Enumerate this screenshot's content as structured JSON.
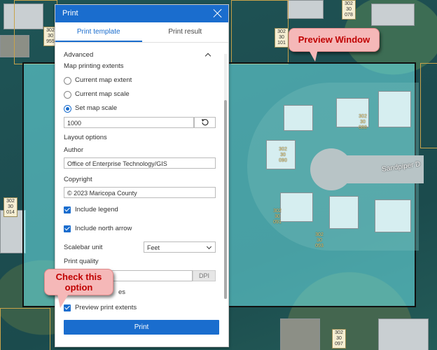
{
  "panel": {
    "title": "Print",
    "tabs": [
      {
        "label": "Print template"
      },
      {
        "label": "Print result"
      }
    ],
    "advanced": {
      "label": "Advanced",
      "extents_label": "Map printing extents",
      "options": [
        {
          "label": "Current map extent"
        },
        {
          "label": "Current map scale"
        },
        {
          "label": "Set map scale"
        }
      ],
      "scale_value": "1000",
      "layout_options_label": "Layout options",
      "author_label": "Author",
      "author_value": "Office of Enterprise Technology/GIS",
      "copyright_label": "Copyright",
      "copyright_value": "© 2023 Maricopa County",
      "include_legend_label": "Include legend",
      "include_north_arrow_label": "Include north arrow",
      "scalebar_unit_label": "Scalebar unit",
      "scalebar_unit_value": "Feet",
      "print_quality_label": "Print quality",
      "dpi_label": "DPI",
      "partial_label": "es",
      "preview_label": "Preview print extents"
    },
    "print_button": "Print"
  },
  "callouts": {
    "preview_window": "Preview Window",
    "check_option": "Check this option"
  },
  "map": {
    "road_label": "Sandpiper D",
    "parcels": [
      {
        "text": "302 30 955"
      },
      {
        "text": "302 30 101"
      },
      {
        "text": "302 30 078"
      },
      {
        "text": "302 30 088"
      },
      {
        "text": "302 30 090"
      },
      {
        "text": "302 30 091"
      },
      {
        "text": "302 30 093"
      },
      {
        "text": "302 30 014"
      },
      {
        "text": "302 30 097"
      }
    ]
  },
  "colors": {
    "accent": "#1a6dce",
    "highlight": "#b9f2ae",
    "callout_bg": "#f5b8b8",
    "callout_text": "#c00000"
  }
}
